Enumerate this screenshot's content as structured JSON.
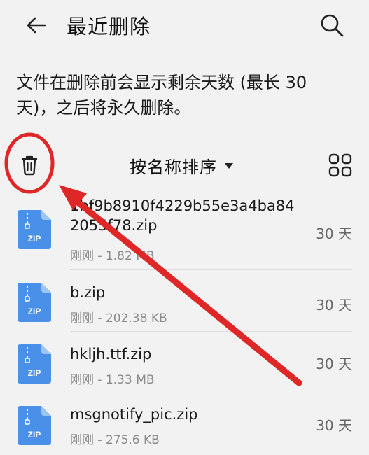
{
  "header": {
    "title": "最近删除",
    "back_icon": "back-arrow-icon",
    "search_icon": "search-icon"
  },
  "notice": {
    "text": "文件在删除前会显示剩余天数 (最长 30 天)，之后将永久删除。"
  },
  "toolbar": {
    "trash_icon": "trash-icon",
    "sort_label": "按名称排序",
    "sort_caret_icon": "caret-down-icon",
    "grid_icon": "grid-view-icon"
  },
  "files": [
    {
      "name": "1bf9b8910f4229b55e3a4ba842055f78.zip",
      "meta": "刚刚 - 1.82 MB",
      "days": "30 天",
      "type_label": "ZIP"
    },
    {
      "name": "b.zip",
      "meta": "刚刚 - 202.38 KB",
      "days": "30 天",
      "type_label": "ZIP"
    },
    {
      "name": "hkljh.ttf.zip",
      "meta": "刚刚 - 1.33 MB",
      "days": "30 天",
      "type_label": "ZIP"
    },
    {
      "name": "msgnotify_pic.zip",
      "meta": "刚刚 - 275.6 KB",
      "days": "30 天",
      "type_label": "ZIP"
    }
  ],
  "colors": {
    "file_icon": "#4a90e8",
    "annotation": "#e02727"
  }
}
